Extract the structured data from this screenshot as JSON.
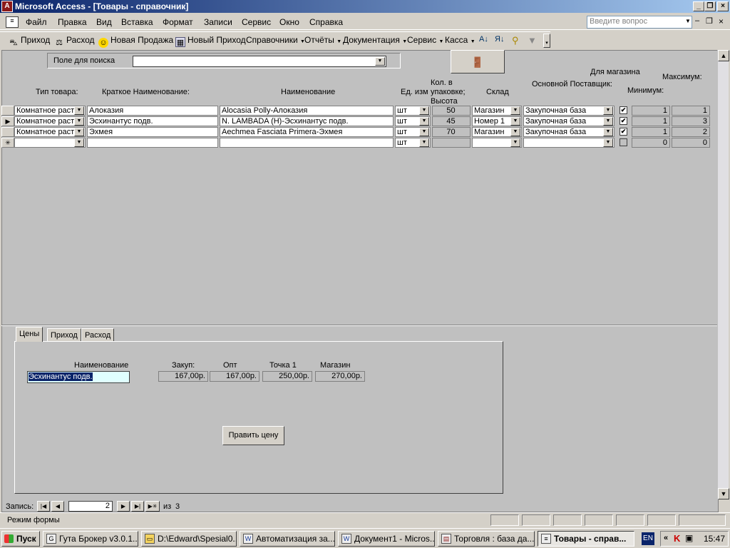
{
  "window": {
    "title": "Microsoft Access - [Товары - справочник]",
    "app_icon": "access-icon"
  },
  "menu": {
    "items": [
      "Файл",
      "Правка",
      "Вид",
      "Вставка",
      "Формат",
      "Записи",
      "Сервис",
      "Окно",
      "Справка"
    ],
    "ask_placeholder": "Введите вопрос"
  },
  "toolbar": {
    "items": [
      "Приход",
      "Расход",
      "Новая Продажа",
      "Новый Приход",
      "Справочники",
      "Отчёты",
      "Документация",
      "Сервис",
      "Касса"
    ]
  },
  "search": {
    "label": "Поле для поиска",
    "value": ""
  },
  "headers": {
    "type": "Тип товара:",
    "short_name": "Краткое Наименование:",
    "name": "Наименование",
    "unit": "Ед. изм",
    "qty": "Кол. в упаковке; Высота",
    "warehouse": "Склад",
    "supplier": "Основной Поставщик:",
    "for_store": "Для магазина",
    "min": "Минимум:",
    "max": "Максимум:"
  },
  "rows": [
    {
      "type": "Комнатное раст",
      "short": "Алоказия",
      "name": "Alocasia Polly-Алоказия",
      "unit": "шт",
      "qty": "50",
      "warehouse": "Магазин",
      "supplier": "Закупочная база",
      "check": "✔",
      "min": "1",
      "max": "1",
      "selector": ""
    },
    {
      "type": "Комнатное раст",
      "short": "Эсхинантус подв.",
      "name": "N. LAMBADA (H)-Эсхинантус подв.",
      "unit": "шт",
      "qty": "45",
      "warehouse": "Номер 1",
      "supplier": "Закупочная база",
      "check": "✔",
      "min": "1",
      "max": "3",
      "selector": "▶"
    },
    {
      "type": "Комнатное раст",
      "short": "Эхмея",
      "name": "Aechmea Fasciata Primera-Эхмея",
      "unit": "шт",
      "qty": "70",
      "warehouse": "Магазин",
      "supplier": "Закупочная база",
      "check": "✔",
      "min": "1",
      "max": "2",
      "selector": ""
    }
  ],
  "new_row": {
    "unit": "шт",
    "min": "0",
    "max": "0",
    "selector": "✳"
  },
  "tabs": [
    "Цены",
    "Приход",
    "Расход"
  ],
  "prices": {
    "name_label": "Наименование",
    "name_value": "Эсхинантус подв.",
    "labels": [
      "Закуп:",
      "Опт",
      "Точка 1",
      "Магазин"
    ],
    "values": [
      "167,00р.",
      "167,00р.",
      "250,00р.",
      "270,00р."
    ],
    "edit_button": "Править цену"
  },
  "nav": {
    "label": "Запись:",
    "current": "2",
    "of_label": "из",
    "total": "3"
  },
  "status": {
    "text": "Режим формы"
  },
  "taskbar": {
    "start": "Пуск",
    "tasks": [
      "Гута Брокер v3.0.1...",
      "D:\\Edward\\Spesial0...",
      "Автоматизация за...",
      "Документ1 - Micros...",
      "Торговля : база да...",
      "Товары - справ..."
    ],
    "lang": "EN",
    "time": "15:47"
  }
}
